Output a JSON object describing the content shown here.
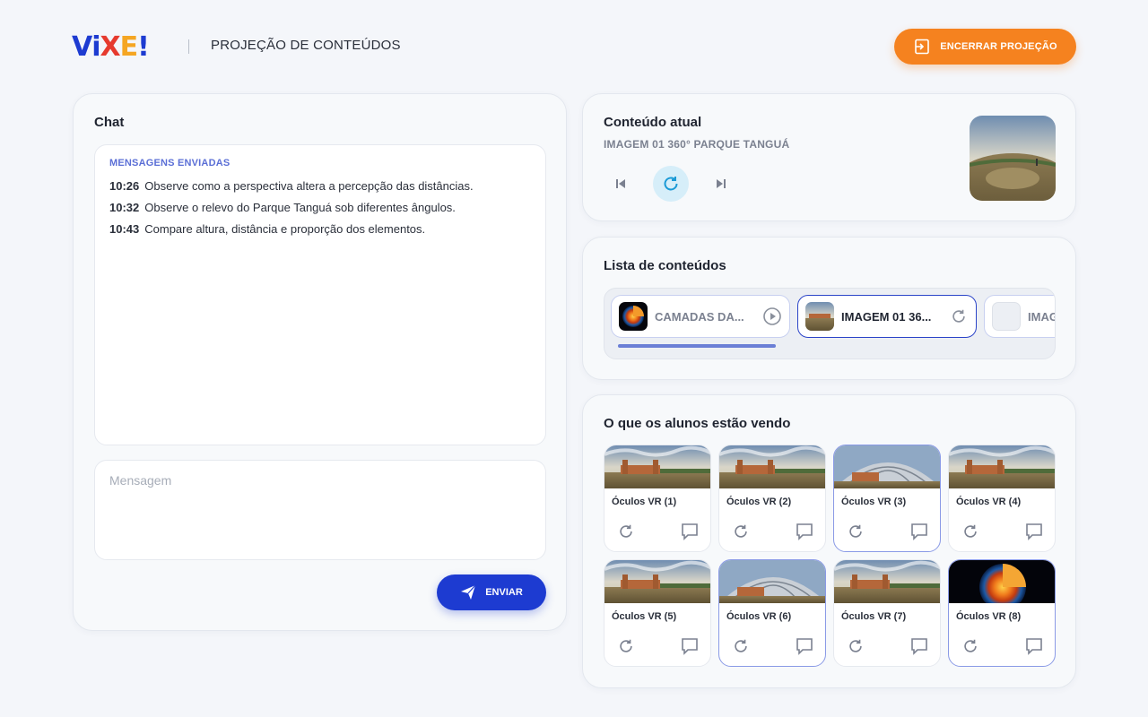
{
  "header": {
    "logo": "VIXE!",
    "title": "PROJEÇÃO DE CONTEÚDOS",
    "end_button_label": "ENCERRAR PROJEÇÃO"
  },
  "chat": {
    "title": "Chat",
    "messages_heading": "MENSAGENS ENVIADAS",
    "messages": [
      {
        "time": "10:26",
        "text": "Observe como a perspectiva altera a percepção das distâncias."
      },
      {
        "time": "10:32",
        "text": "Observe o relevo do Parque Tanguá sob diferentes ângulos."
      },
      {
        "time": "10:43",
        "text": "Compare altura, distância e proporção dos elementos."
      }
    ],
    "input_placeholder": "Mensagem",
    "send_label": "ENVIAR"
  },
  "current": {
    "title": "Conteúdo atual",
    "subtitle": "IMAGEM 01 360° PARQUE TANGUÁ"
  },
  "content_list": {
    "title": "Lista de conteúdos",
    "items": [
      {
        "label": "CAMADAS DA...",
        "icon": "play-icon"
      },
      {
        "label": "IMAGEM 01 36...",
        "icon": "reload-icon"
      },
      {
        "label": "IMAG",
        "icon": ""
      }
    ]
  },
  "students": {
    "title": "O que os alunos estão vendo",
    "devices": [
      {
        "label": "Óculos VR (1)"
      },
      {
        "label": "Óculos VR (2)"
      },
      {
        "label": "Óculos VR (3)"
      },
      {
        "label": "Óculos VR (4)"
      },
      {
        "label": "Óculos VR (5)"
      },
      {
        "label": "Óculos VR (6)"
      },
      {
        "label": "Óculos VR (7)"
      },
      {
        "label": "Óculos VR (8)"
      }
    ]
  },
  "colors": {
    "accent_orange": "#f5821f",
    "accent_blue": "#1d3bd1",
    "heading_blue": "#5b6fd6"
  }
}
